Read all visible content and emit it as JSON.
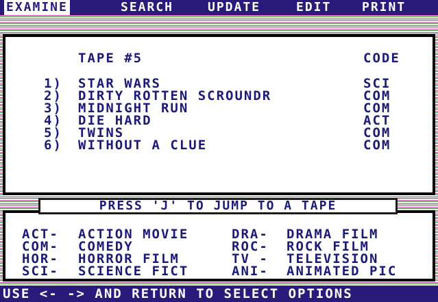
{
  "menu": {
    "items": [
      "EXAMINE",
      "SEARCH",
      "UPDATE",
      "EDIT",
      "PRINT"
    ],
    "active": "EXAMINE"
  },
  "tape": {
    "title": "TAPE #5",
    "code_header": "CODE",
    "items": [
      {
        "number": "1)",
        "title": "STAR WARS",
        "code": "SCI"
      },
      {
        "number": "2)",
        "title": "DIRTY ROTTEN SCROUNDR",
        "code": "COM"
      },
      {
        "number": "3)",
        "title": "MIDNIGHT RUN",
        "code": "COM"
      },
      {
        "number": "4)",
        "title": "DIE HARD",
        "code": "ACT"
      },
      {
        "number": "5)",
        "title": "TWINS",
        "code": "COM"
      },
      {
        "number": "6)",
        "title": "WITHOUT A CLUE",
        "code": "COM"
      }
    ]
  },
  "jump_prompt": "PRESS 'J' TO JUMP TO A TAPE",
  "legend": {
    "left": [
      {
        "code": "ACT-",
        "desc": "ACTION MOVIE"
      },
      {
        "code": "COM-",
        "desc": "COMEDY"
      },
      {
        "code": "HOR-",
        "desc": "HORROR FILM"
      },
      {
        "code": "SCI-",
        "desc": "SCIENCE FICT"
      }
    ],
    "right": [
      {
        "code": "DRA-",
        "desc": "DRAMA FILM"
      },
      {
        "code": "ROC-",
        "desc": "ROCK FILM"
      },
      {
        "code": "TV -",
        "desc": "TELEVISION"
      },
      {
        "code": "ANI-",
        "desc": "ANIMATED PIC"
      }
    ]
  },
  "footer": "USE <- -> AND RETURN TO SELECT OPTIONS",
  "colors": {
    "menu_bg": "#2a1a7a",
    "text_blue": "#1c1a78",
    "stripe_magenta": "#c8379a",
    "stripe_green": "#2f8a2a"
  }
}
